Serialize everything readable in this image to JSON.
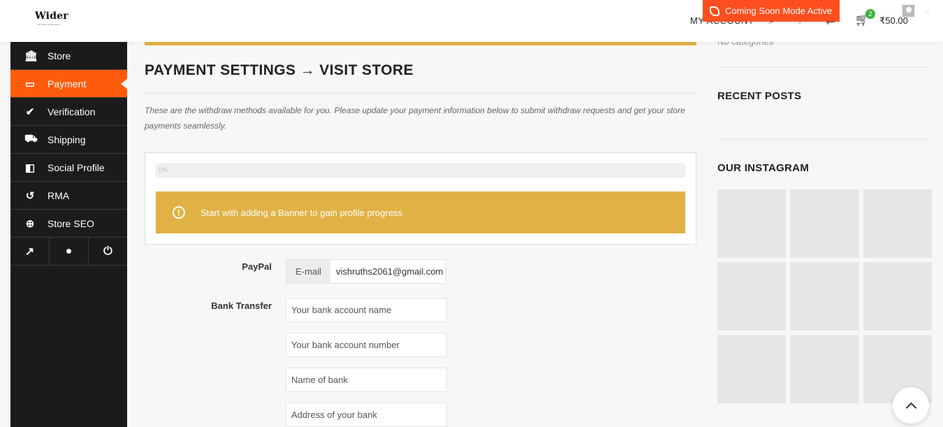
{
  "header": {
    "logo_text": "Wider",
    "logo_tagline": "All in ad is all you need",
    "coming_soon": "Coming Soon Mode Active",
    "my_account": "MY ACCOUNT",
    "cart_count": "2",
    "cart_price": "₹50.00"
  },
  "sidebar": {
    "items": [
      {
        "label": "Store",
        "icon": "bank-icon",
        "glyph": "🏛"
      },
      {
        "label": "Payment",
        "icon": "credit-card-icon",
        "glyph": "▭"
      },
      {
        "label": "Verification",
        "icon": "check-icon",
        "glyph": "✔"
      },
      {
        "label": "Shipping",
        "icon": "truck-icon",
        "glyph": "⛟"
      },
      {
        "label": "Social Profile",
        "icon": "share-icon",
        "glyph": "◧"
      },
      {
        "label": "RMA",
        "icon": "undo-icon",
        "glyph": "↺"
      },
      {
        "label": "Store SEO",
        "icon": "globe-icon",
        "glyph": "⊕"
      }
    ],
    "bottom_icons": [
      {
        "icon": "external-link-icon",
        "glyph": "↗"
      },
      {
        "icon": "user-icon",
        "glyph": "●"
      },
      {
        "icon": "power-icon",
        "glyph": "⏻"
      }
    ]
  },
  "main": {
    "title": "PAYMENT SETTINGS → VISIT STORE",
    "intro": "These are the withdraw methods available for you. Please update your payment information below to submit withdraw requests and get your store payments seamlessly.",
    "progress_percent": "0%",
    "progress_value": 0,
    "alert_text": "Start with adding a Banner to gain profile progress",
    "paypal": {
      "label": "PayPal",
      "addon": "E-mail",
      "value": "vishruths2061@gmail.com"
    },
    "bank": {
      "label": "Bank Transfer",
      "account_name_placeholder": "Your bank account name",
      "account_number_placeholder": "Your bank account number",
      "bank_name_placeholder": "Name of bank",
      "bank_address_placeholder": "Address of your bank"
    }
  },
  "right": {
    "no_categories": "No categories",
    "recent_posts_title": "RECENT POSTS",
    "instagram_title": "OUR INSTAGRAM",
    "instagram_tiles": 9
  }
}
